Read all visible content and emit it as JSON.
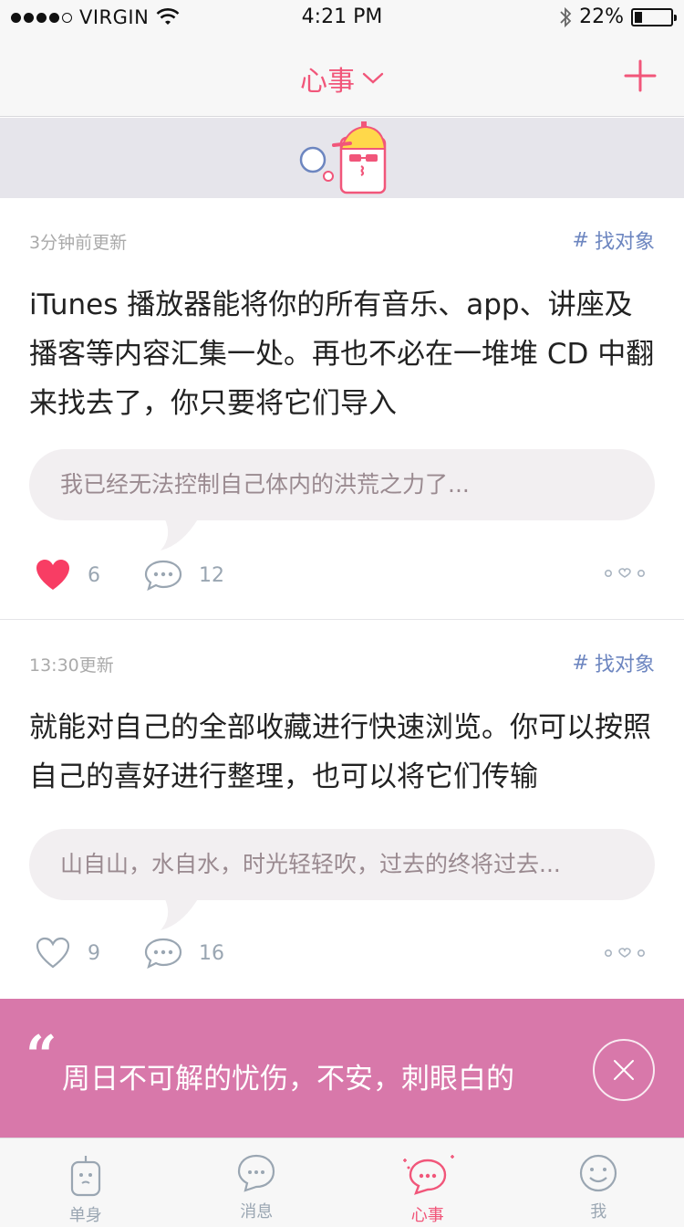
{
  "status_bar": {
    "carrier": "VIRGIN",
    "time": "4:21 PM",
    "battery": "22%",
    "battery_level": 0.22
  },
  "nav": {
    "title": "心事",
    "add_icon": "plus-icon"
  },
  "posts": [
    {
      "time": "3分钟前更新",
      "tag": "找对象",
      "body": "iTunes 播放器能将你的所有音乐、app、讲座及播客等内容汇集一处。再也不必在一堆堆 CD 中翻来找去了，你只要将它们导入",
      "quote": "我已经无法控制自己体内的洪荒之力了...",
      "likes": "6",
      "liked": true,
      "comments": "12"
    },
    {
      "time": "13:30更新",
      "tag": "找对象",
      "body": "就能对自己的全部收藏进行快速浏览。你可以按照自己的喜好进行整理，也可以将它们传输",
      "quote": "山自山，水自水，时光轻轻吹，过去的终将过去...",
      "likes": "9",
      "liked": false,
      "comments": "16"
    }
  ],
  "promo": {
    "quote_mark": "“",
    "text": "周日不可解的忧伤，不安，刺眼白的"
  },
  "tabs": [
    {
      "label": "单身",
      "icon": "single-icon",
      "active": false
    },
    {
      "label": "消息",
      "icon": "message-icon",
      "active": false
    },
    {
      "label": "心事",
      "icon": "heart-chat-icon",
      "active": true
    },
    {
      "label": "我",
      "icon": "me-icon",
      "active": false
    }
  ],
  "colors": {
    "accent": "#f1567a",
    "tag": "#6d86c0",
    "promo_bg": "#d878aa",
    "banner_bg": "#e6e5eb"
  }
}
